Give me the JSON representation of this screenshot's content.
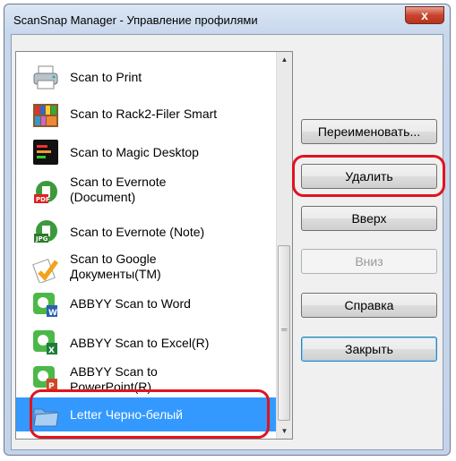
{
  "window": {
    "title": "ScanSnap Manager - Управление профилями",
    "close_label": "x"
  },
  "profiles": [
    {
      "label": "Scan to Print",
      "icon": "printer-icon"
    },
    {
      "label": "Scan to Rack2-Filer Smart",
      "icon": "bookshelf-icon"
    },
    {
      "label": "Scan to Magic Desktop",
      "icon": "magic-desktop-icon"
    },
    {
      "label": "Scan to Evernote\n(Document)",
      "icon": "pdf-icon"
    },
    {
      "label": "Scan to Evernote (Note)",
      "icon": "jpg-icon"
    },
    {
      "label": "Scan to Google\nДокументы(TM)",
      "icon": "google-docs-icon"
    },
    {
      "label": "ABBYY Scan to Word",
      "icon": "abbyy-word-icon"
    },
    {
      "label": "ABBYY Scan to Excel(R)",
      "icon": "abbyy-excel-icon"
    },
    {
      "label": "ABBYY Scan to\nPowerPoint(R)",
      "icon": "abbyy-powerpoint-icon"
    },
    {
      "label": "Letter Черно-белый",
      "icon": "folder-icon",
      "selected": true
    }
  ],
  "buttons": {
    "rename": "Переименовать...",
    "delete": "Удалить",
    "up": "Вверх",
    "down": "Вниз",
    "help": "Справка",
    "close": "Закрыть"
  },
  "colors": {
    "highlight": "#e0141e",
    "selection": "#3399ff"
  }
}
